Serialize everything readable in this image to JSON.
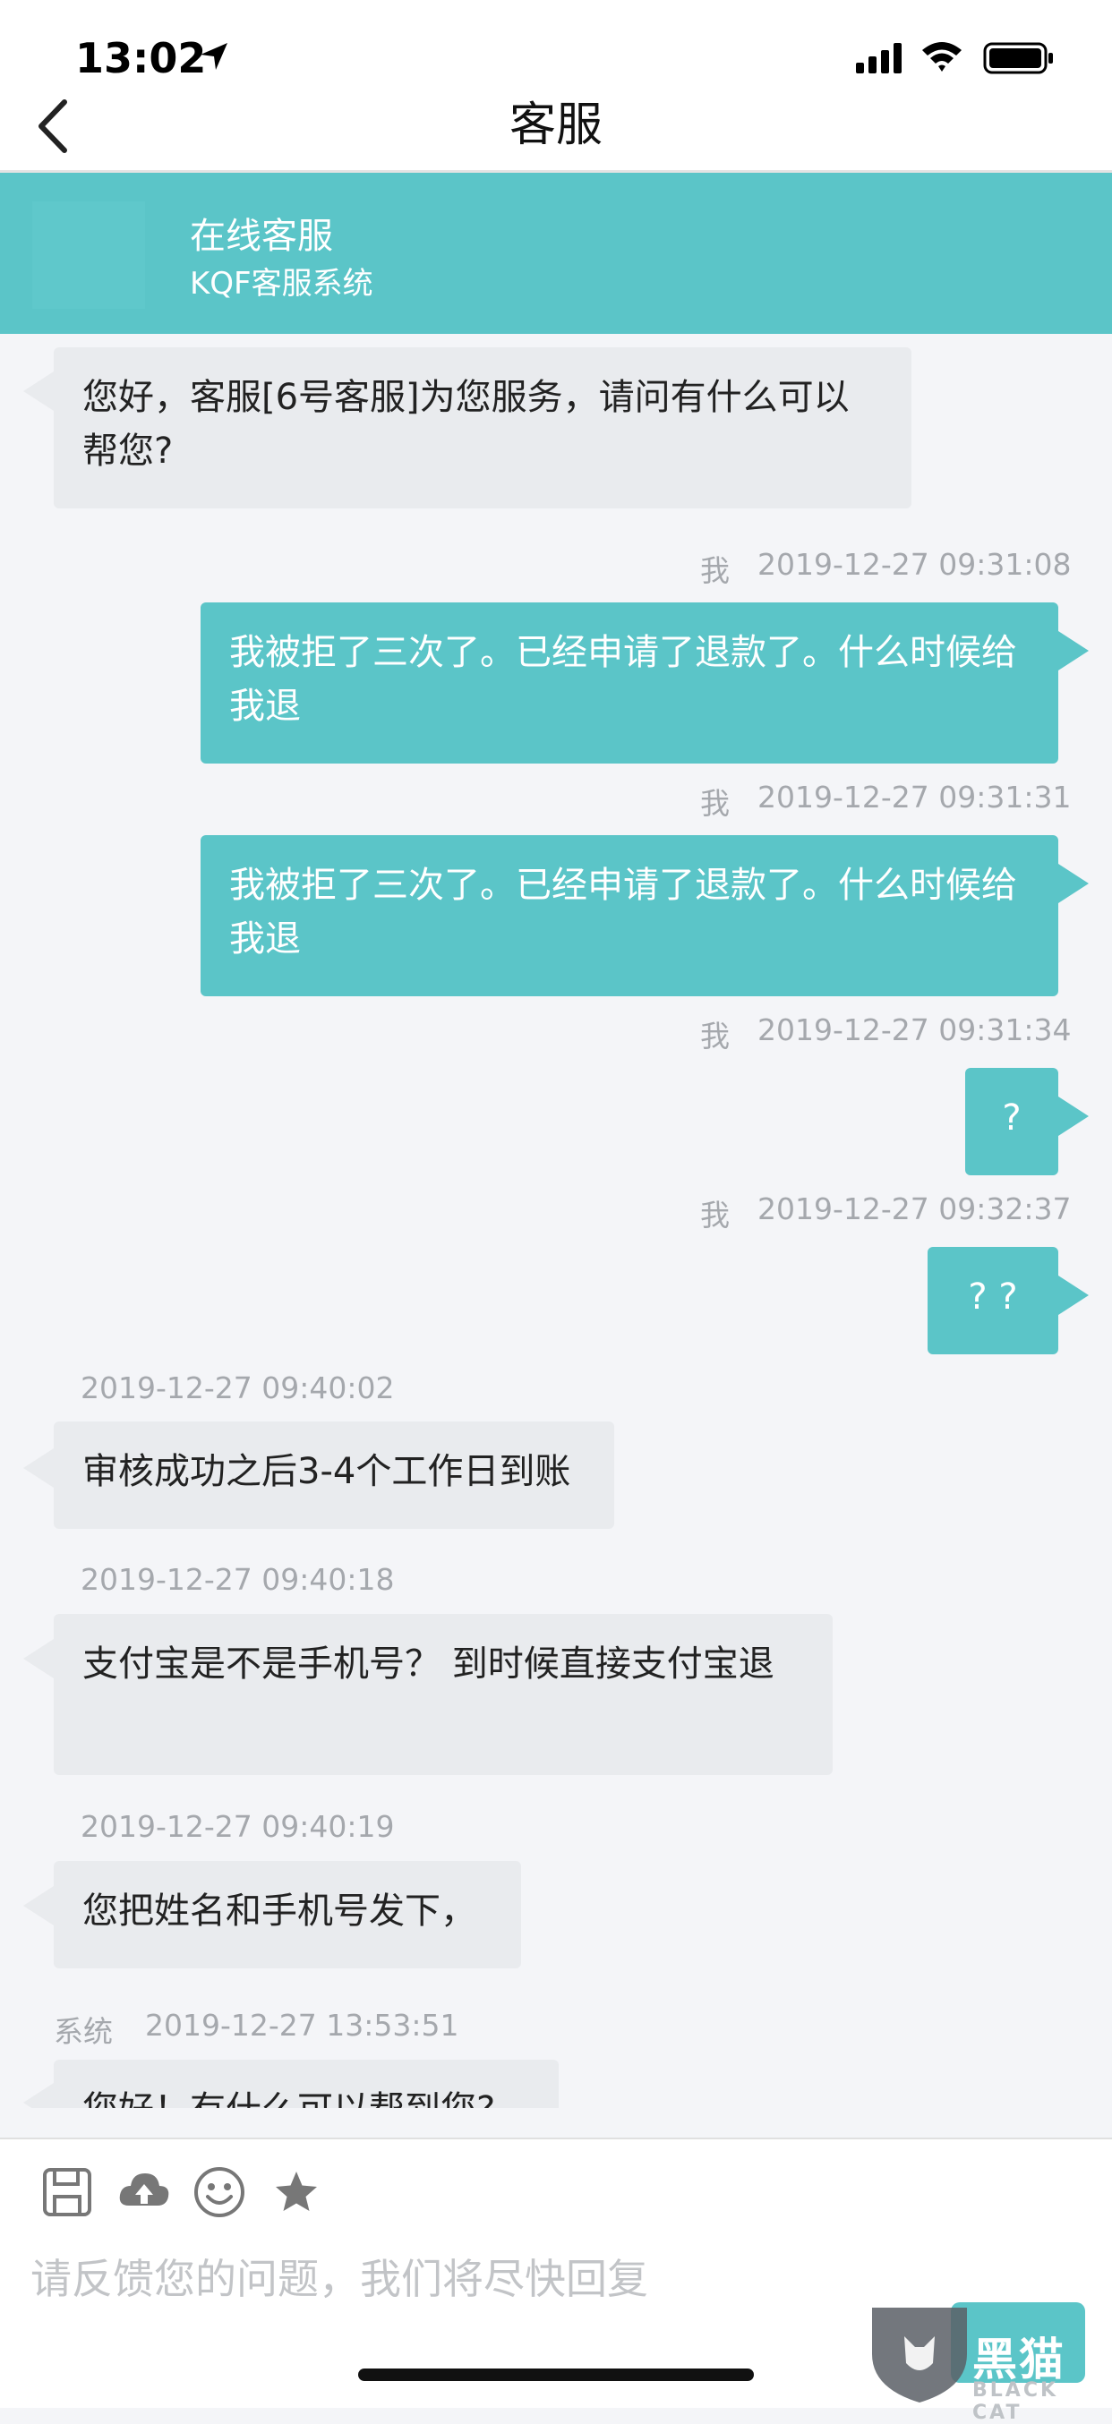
{
  "status_bar": {
    "time": "13:02"
  },
  "nav": {
    "title": "客服"
  },
  "agent": {
    "name": "在线客服",
    "system": "KQF客服系统"
  },
  "messages": [
    {
      "side": "in",
      "text": "您好，客服[6号客服]为您服务，请问有什么可以帮您?"
    },
    {
      "side": "out",
      "sender": "我",
      "time": "2019-12-27 09:31:08",
      "text": "我被拒了三次了。已经申请了退款了。什么时候给我退"
    },
    {
      "side": "out",
      "sender": "我",
      "time": "2019-12-27 09:31:31",
      "text": "我被拒了三次了。已经申请了退款了。什么时候给我退"
    },
    {
      "side": "out",
      "sender": "我",
      "time": "2019-12-27 09:31:34",
      "text": "?"
    },
    {
      "side": "out",
      "sender": "我",
      "time": "2019-12-27 09:32:37",
      "text": "? ?"
    },
    {
      "side": "in",
      "time": "2019-12-27 09:40:02",
      "text": "审核成功之后3-4个工作日到账"
    },
    {
      "side": "in",
      "time": "2019-12-27 09:40:18",
      "text": "支付宝是不是手机号？ 到时候直接支付宝退"
    },
    {
      "side": "in",
      "time": "2019-12-27 09:40:19",
      "text": "您把姓名和手机号发下，"
    },
    {
      "side": "in",
      "sender": "系统",
      "time": "2019-12-27 13:53:51",
      "text": "您好！有什么可以帮到您?"
    }
  ],
  "input": {
    "placeholder": "请反馈您的问题，我们将尽快回复"
  },
  "toolbar_icons": [
    "save-icon",
    "cloud-upload-icon",
    "smiley-icon",
    "star-icon"
  ],
  "watermark": {
    "text": "黑猫",
    "sub": "BLACK CAT"
  },
  "colors": {
    "accent": "#5bc5c8",
    "incoming_bubble": "#e9ebee",
    "background": "#f4f5f8"
  }
}
